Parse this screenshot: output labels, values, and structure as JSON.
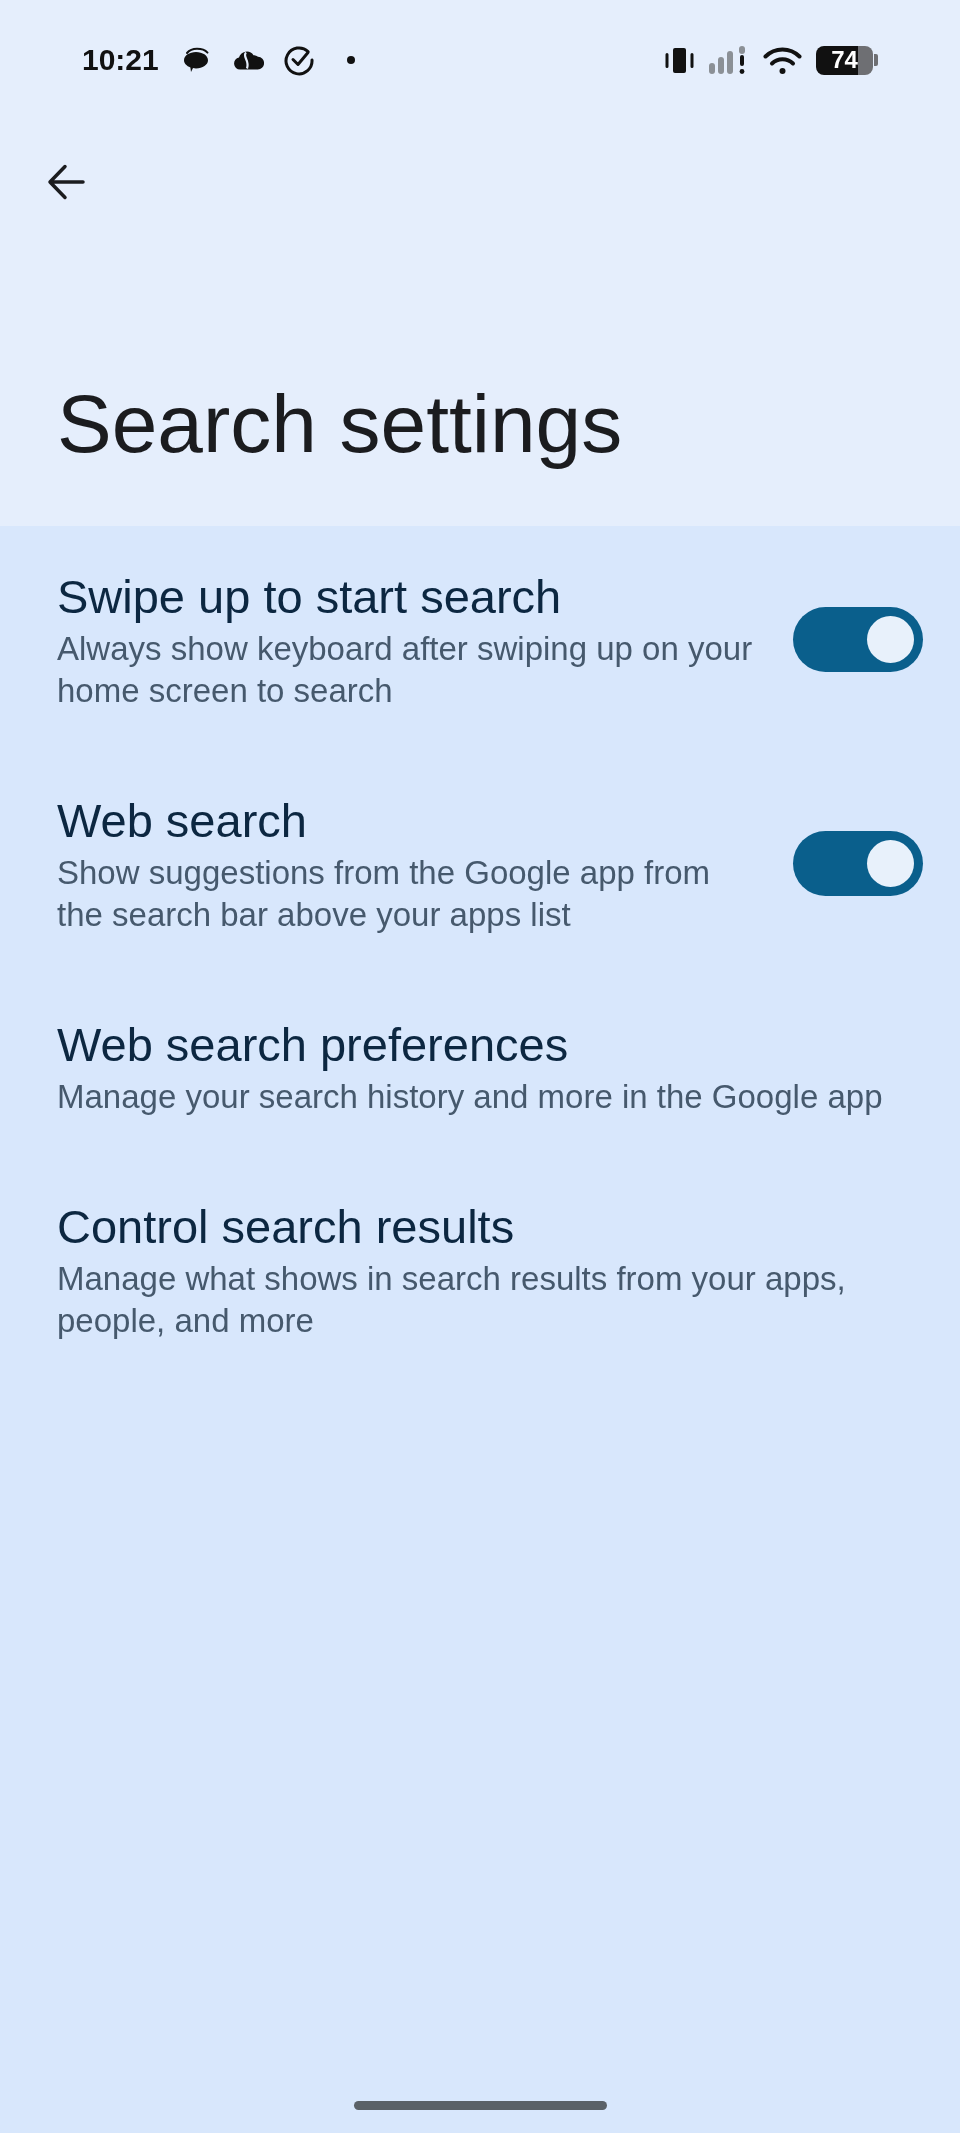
{
  "status_bar": {
    "time": "10:21",
    "battery": "74"
  },
  "header": {
    "title": "Search settings"
  },
  "settings": [
    {
      "kind": "switch",
      "title": "Swipe up to start search",
      "summary": "Always show keyboard after swiping up on your home screen to search",
      "on": true
    },
    {
      "kind": "switch",
      "title": "Web search",
      "summary": "Show suggestions from the Google app from the search bar above your apps list",
      "on": true
    },
    {
      "kind": "link",
      "title": "Web search preferences",
      "summary": "Manage your search history and more in the Google app"
    },
    {
      "kind": "link",
      "title": "Control search results",
      "summary": "Manage what shows in search results from your apps, people, and more"
    }
  ]
}
